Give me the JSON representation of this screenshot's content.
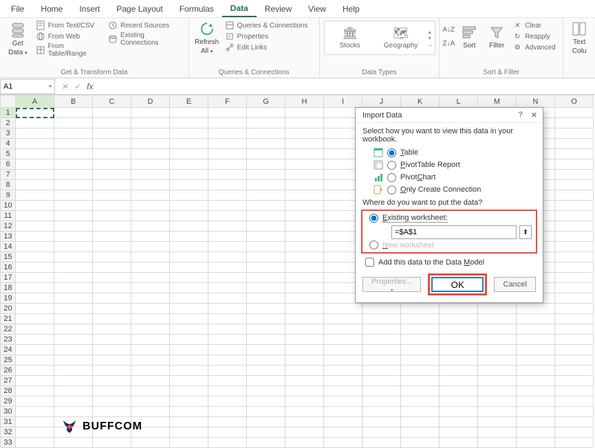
{
  "menu": {
    "items": [
      "File",
      "Home",
      "Insert",
      "Page Layout",
      "Formulas",
      "Data",
      "Review",
      "View",
      "Help"
    ],
    "active": "Data"
  },
  "ribbon": {
    "group_get": {
      "big": {
        "label_line1": "Get",
        "label_line2": "Data"
      },
      "items": [
        "From Text/CSV",
        "From Web",
        "From Table/Range",
        "Recent Sources",
        "Existing Connections"
      ],
      "label": "Get & Transform Data"
    },
    "group_queries": {
      "big": {
        "label_line1": "Refresh",
        "label_line2": "All"
      },
      "items": [
        "Queries & Connections",
        "Properties",
        "Edit Links"
      ],
      "label": "Queries & Connections"
    },
    "group_types": {
      "items": [
        "Stocks",
        "Geography"
      ],
      "label": "Data Types"
    },
    "group_sort": {
      "sort": "Sort",
      "filter": "Filter",
      "clear": "Clear",
      "reapply": "Reapply",
      "advanced": "Advanced",
      "label": "Sort & Filter"
    },
    "group_tools": {
      "text_to_cols_line1": "Text",
      "text_to_cols_line2": "Colu"
    }
  },
  "namebox": {
    "value": "A1"
  },
  "formula": {
    "value": ""
  },
  "columns": [
    "A",
    "B",
    "C",
    "D",
    "E",
    "F",
    "G",
    "H",
    "I",
    "J",
    "K",
    "L",
    "M",
    "N",
    "O"
  ],
  "rows": [
    "1",
    "2",
    "3",
    "4",
    "5",
    "6",
    "7",
    "8",
    "9",
    "10",
    "11",
    "12",
    "13",
    "14",
    "15",
    "16",
    "17",
    "18",
    "19",
    "20",
    "21",
    "22",
    "23",
    "24",
    "25",
    "26",
    "27",
    "28",
    "29",
    "30",
    "31",
    "32",
    "33"
  ],
  "dialog": {
    "title": "Import Data",
    "help": "?",
    "prompt1": "Select how you want to view this data in your workbook.",
    "opt_table_prefix": "T",
    "opt_table_rest": "able",
    "opt_pivot_prefix": "P",
    "opt_pivot_rest": "ivotTable Report",
    "opt_chart_prefix": "C",
    "opt_chart_mid": "Pivot",
    "opt_chart_suffix": "hart",
    "opt_conn_prefix": "O",
    "opt_conn_rest": "nly Create Connection",
    "prompt2": "Where do you want to put the data?",
    "opt_exist_prefix": "E",
    "opt_exist_rest": "xisting worksheet:",
    "dest_value": "=$A$1",
    "opt_new_prefix": "N",
    "opt_new_rest": "ew worksheet",
    "add_model_text": "Add this data to the Data ",
    "add_model_u": "M",
    "add_model_suffix": "odel",
    "btn_props": "Properties...",
    "btn_ok": "OK",
    "btn_cancel": "Cancel"
  },
  "watermark": {
    "text": "BUFFCOM"
  }
}
